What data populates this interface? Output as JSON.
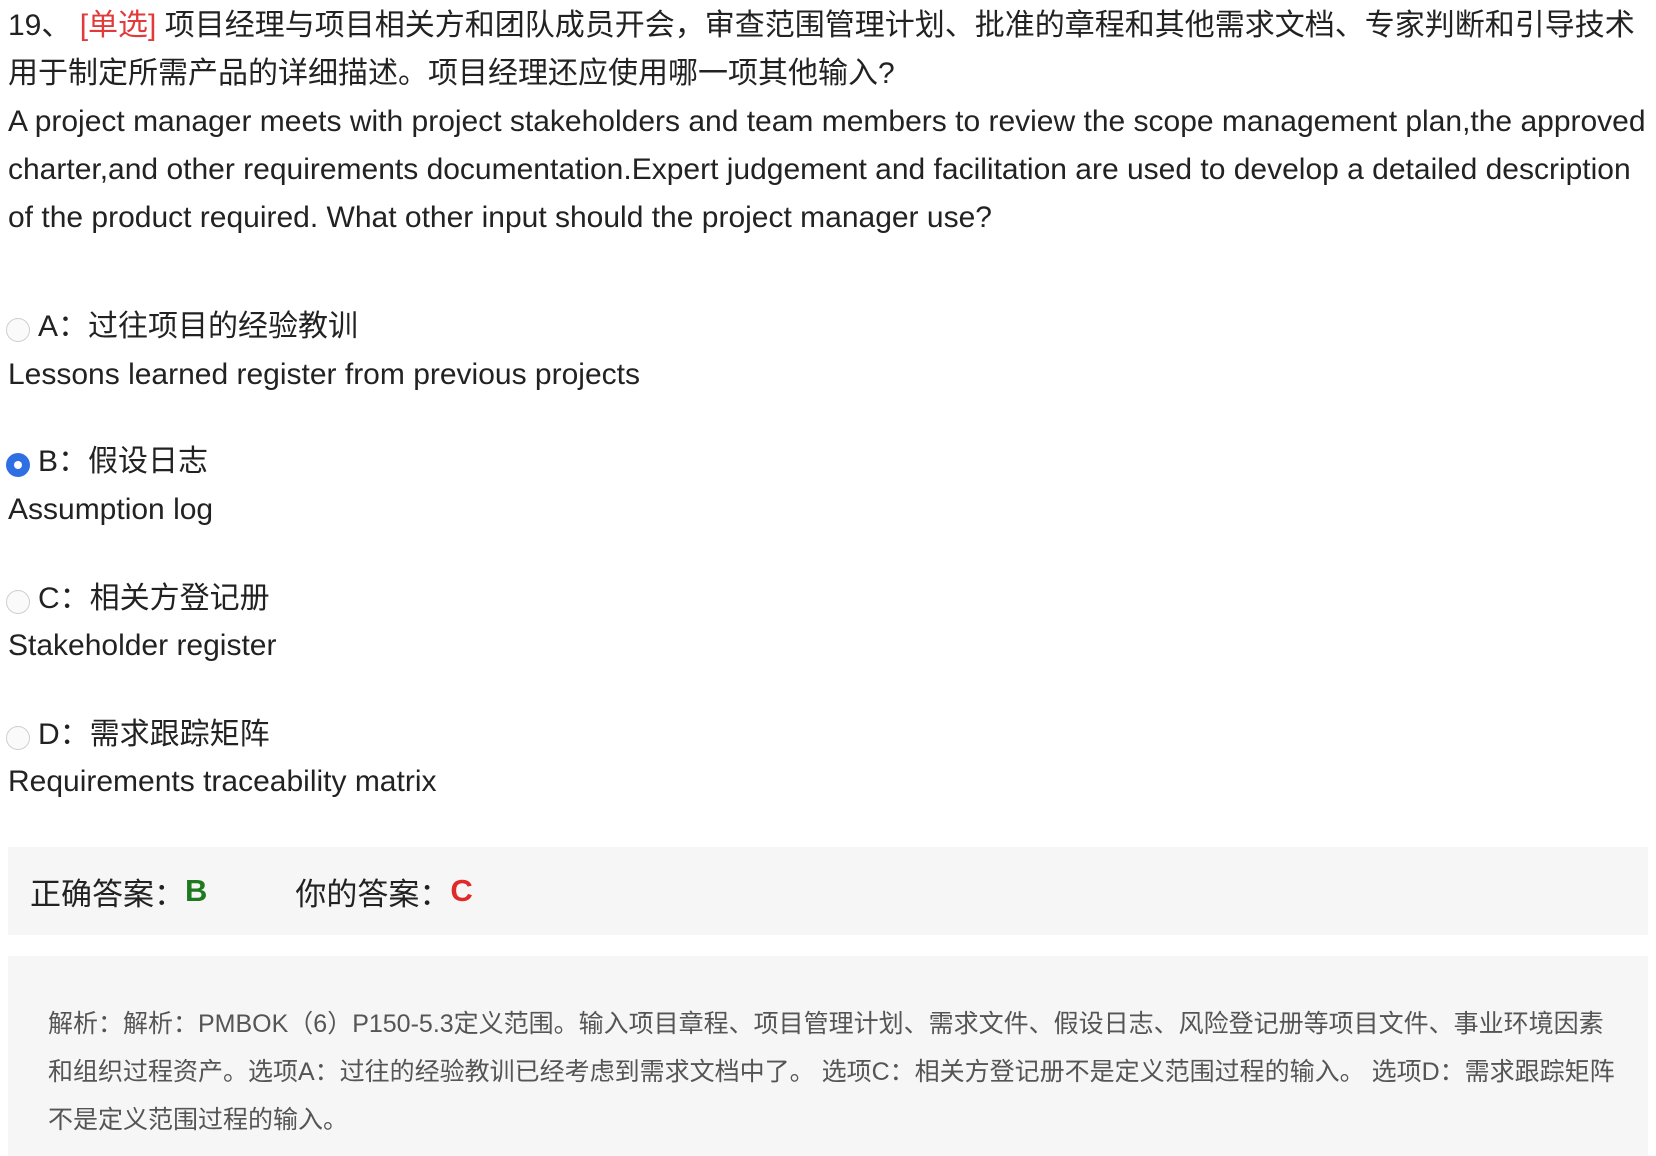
{
  "question": {
    "number": "19、",
    "type_tag": "[单选]",
    "text_zh": "项目经理与项目相关方和团队成员开会，审查范围管理计划、批准的章程和其他需求文档、专家判断和引导技术用于制定所需产品的详细描述。项目经理还应使用哪一项其他输入?",
    "text_en": "A project manager meets with project stakeholders and team members to review the scope management plan,the approved charter,and other requirements documentation.Expert judgement and facilitation are used to develop a detailed description of the product required. What other input should the project manager use?"
  },
  "options": [
    {
      "label": "A：过往项目的经验教训",
      "text_en": "Lessons learned register from previous projects",
      "selected": false
    },
    {
      "label": "B：假设日志",
      "text_en": "Assumption log",
      "selected": true
    },
    {
      "label": "C：相关方登记册",
      "text_en": "Stakeholder register",
      "selected": false
    },
    {
      "label": "D：需求跟踪矩阵",
      "text_en": "Requirements traceability matrix",
      "selected": false
    }
  ],
  "answer": {
    "correct_label": "正确答案：",
    "correct_value": "B",
    "yours_label": "你的答案：",
    "yours_value": "C",
    "correct_color": "#1e7a1e",
    "yours_color": "#e02a2a"
  },
  "explanation": "解析：解析：PMBOK（6）P150-5.3定义范围。输入项目章程、项目管理计划、需求文件、假设日志、风险登记册等项目文件、事业环境因素和组织过程资产。选项A：过往的经验教训已经考虑到需求文档中了。 选项C：相关方登记册不是定义范围过程的输入。 选项D：需求跟踪矩阵不是定义范围过程的输入。"
}
